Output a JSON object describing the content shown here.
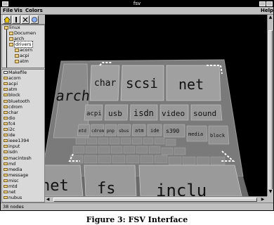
{
  "window": {
    "title": "fsv",
    "menu": [
      "File",
      "Vis",
      "Colors"
    ],
    "help_label": "Help"
  },
  "toolbar": {
    "buttons": [
      "home-icon",
      "up-icon",
      "back-icon",
      "birdseye-icon"
    ]
  },
  "tree": {
    "items": [
      {
        "label": "linux"
      },
      {
        "label": "Documen"
      },
      {
        "label": "arch"
      },
      {
        "label": "drivers"
      },
      {
        "label": "acorn"
      },
      {
        "label": "acpi"
      },
      {
        "label": "atm"
      }
    ]
  },
  "list": {
    "items": [
      "Makefile",
      "acorn",
      "acpi",
      "atm",
      "block",
      "bluetooth",
      "cdrom",
      "char",
      "dio",
      "fc4",
      "i2c",
      "ide",
      "ieee1394",
      "input",
      "isdn",
      "macintosh",
      "md",
      "media",
      "message",
      "misc",
      "mtd",
      "net",
      "nubus"
    ]
  },
  "viewer": {
    "blocks": [
      {
        "label": "arch"
      },
      {
        "label": "char"
      },
      {
        "label": "scsi"
      },
      {
        "label": "net"
      },
      {
        "label": "acpi"
      },
      {
        "label": "usb"
      },
      {
        "label": "isdn"
      },
      {
        "label": "video"
      },
      {
        "label": "sound"
      },
      {
        "label": "mtd"
      },
      {
        "label": "cdrom"
      },
      {
        "label": "pnp"
      },
      {
        "label": "sbus"
      },
      {
        "label": "atm"
      },
      {
        "label": "ide"
      },
      {
        "label": "s390"
      },
      {
        "label": "media"
      },
      {
        "label": "block"
      },
      {
        "label": "net"
      },
      {
        "label": "fs"
      },
      {
        "label": "inclu"
      }
    ]
  },
  "status": {
    "text": "38 nodes"
  },
  "caption": "Figure 3: FSV Interface"
}
